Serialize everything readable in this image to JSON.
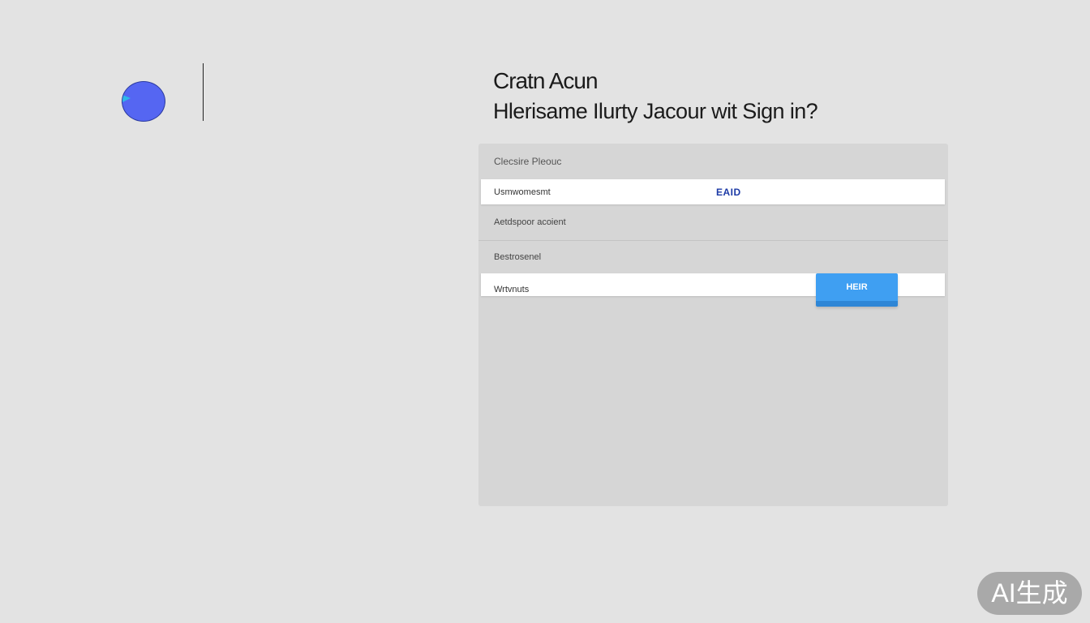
{
  "brand": {
    "logo_icon": "circle-logo-icon",
    "logo_color": "#5566f2",
    "logo_accent_color": "#2fb8e8"
  },
  "heading": {
    "line1": "Cratn Acun",
    "line2": "Hlerisame Ilurty  Jacour wit  Sign in?"
  },
  "form": {
    "header": "Clecsire Pleouc",
    "rows": [
      {
        "label": "Usmwomesmt",
        "value": "EAID"
      },
      {
        "label": "Aetdspoor acoient"
      },
      {
        "label": "Bestrosenel"
      },
      {
        "label": "Wrtvnuts"
      }
    ],
    "primary_button": "HEIR",
    "accent_color": "#3f9ff2",
    "value_color": "#1c3aa6"
  },
  "watermark": {
    "text": "AI生成"
  }
}
